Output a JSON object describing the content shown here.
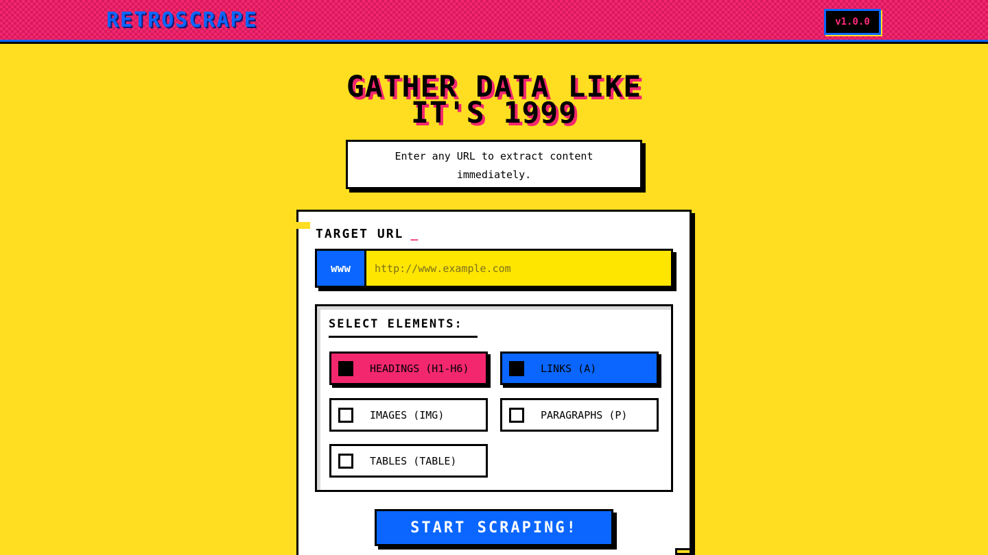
{
  "header": {
    "logo": "RETROSCRAPE",
    "version": "v1.0.0"
  },
  "hero": {
    "title_line1": "GATHER DATA LIKE",
    "title_line2": "IT'S 1999",
    "subtitle": "Enter any URL to extract content immediately."
  },
  "form": {
    "target_label": "TARGET URL",
    "cursor": "_",
    "prefix": "www",
    "url_placeholder": "http://www.example.com",
    "url_value": ""
  },
  "elements": {
    "title": "SELECT ELEMENTS:",
    "options": [
      {
        "label": "HEADINGS (H1-H6)",
        "checked": true,
        "color": "#f2276e"
      },
      {
        "label": "LINKS (A)",
        "checked": true,
        "color": "#0a66ff"
      },
      {
        "label": "IMAGES (IMG)",
        "checked": false
      },
      {
        "label": "PARAGRAPHS (P)",
        "checked": false
      },
      {
        "label": "TABLES (TABLE)",
        "checked": false
      }
    ]
  },
  "actions": {
    "start_label": "START SCRAPING!"
  },
  "colors": {
    "background": "#ffde21",
    "pink": "#f2276e",
    "blue": "#0a66ff",
    "input_yellow": "#ffe600"
  }
}
